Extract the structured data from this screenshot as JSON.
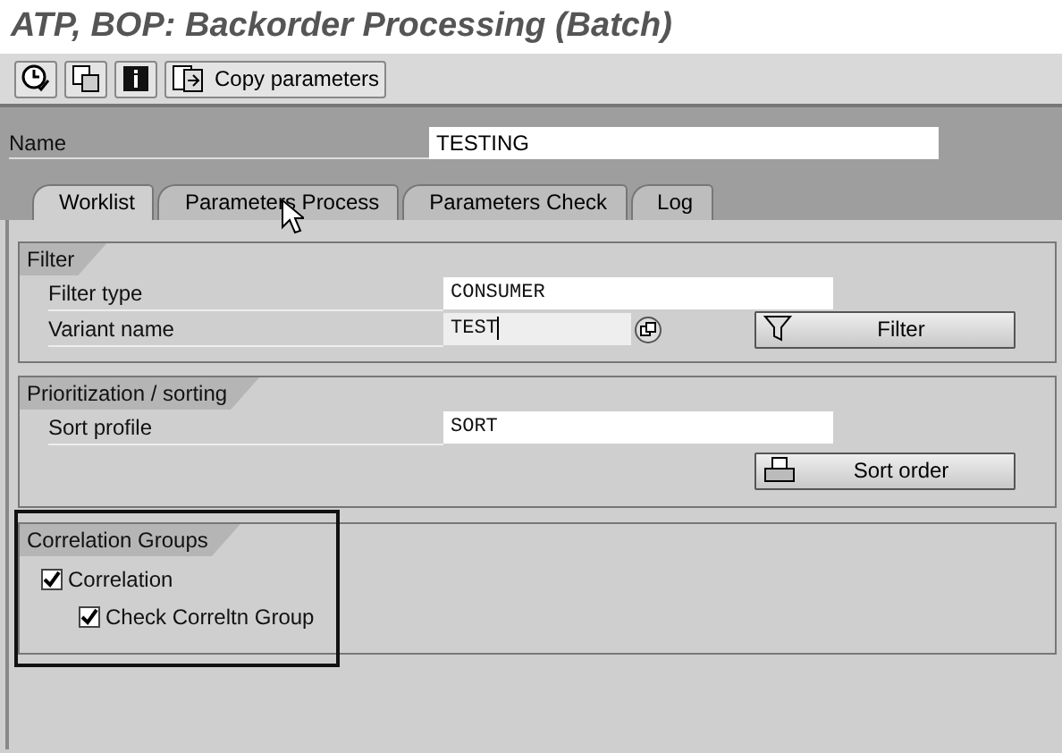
{
  "window": {
    "title": "ATP, BOP: Backorder Processing (Batch)"
  },
  "toolbar": {
    "buttons": [
      {
        "kind": "clock"
      },
      {
        "kind": "copy"
      },
      {
        "kind": "info"
      },
      {
        "kind": "copy-params",
        "label": "Copy parameters"
      }
    ]
  },
  "name_field": {
    "label": "Name",
    "value": "TESTING"
  },
  "tabs": [
    {
      "label": "Worklist",
      "selected": true
    },
    {
      "label": "Parameters Process",
      "selected": false
    },
    {
      "label": "Parameters Check",
      "selected": false
    },
    {
      "label": "Log",
      "selected": false
    }
  ],
  "groups": [
    {
      "title": "Filter",
      "fields": [
        {
          "label": "Filter type",
          "value": "CONSUMER"
        },
        {
          "label": "Variant name",
          "value": "TEST",
          "focused": true,
          "value_help": true
        }
      ],
      "button": {
        "kind": "filter",
        "label": "Filter"
      }
    },
    {
      "title": "Prioritization / sorting",
      "fields": [
        {
          "label": "Sort profile",
          "value": "SORT"
        }
      ],
      "button": {
        "kind": "printer",
        "label": "Sort order"
      }
    },
    {
      "title": "Correlation Groups",
      "highlighted": true,
      "checkboxes": [
        {
          "label": "Correlation",
          "checked": true,
          "children": [
            {
              "label": "Check Correltn Group",
              "checked": true
            }
          ]
        }
      ]
    }
  ]
}
